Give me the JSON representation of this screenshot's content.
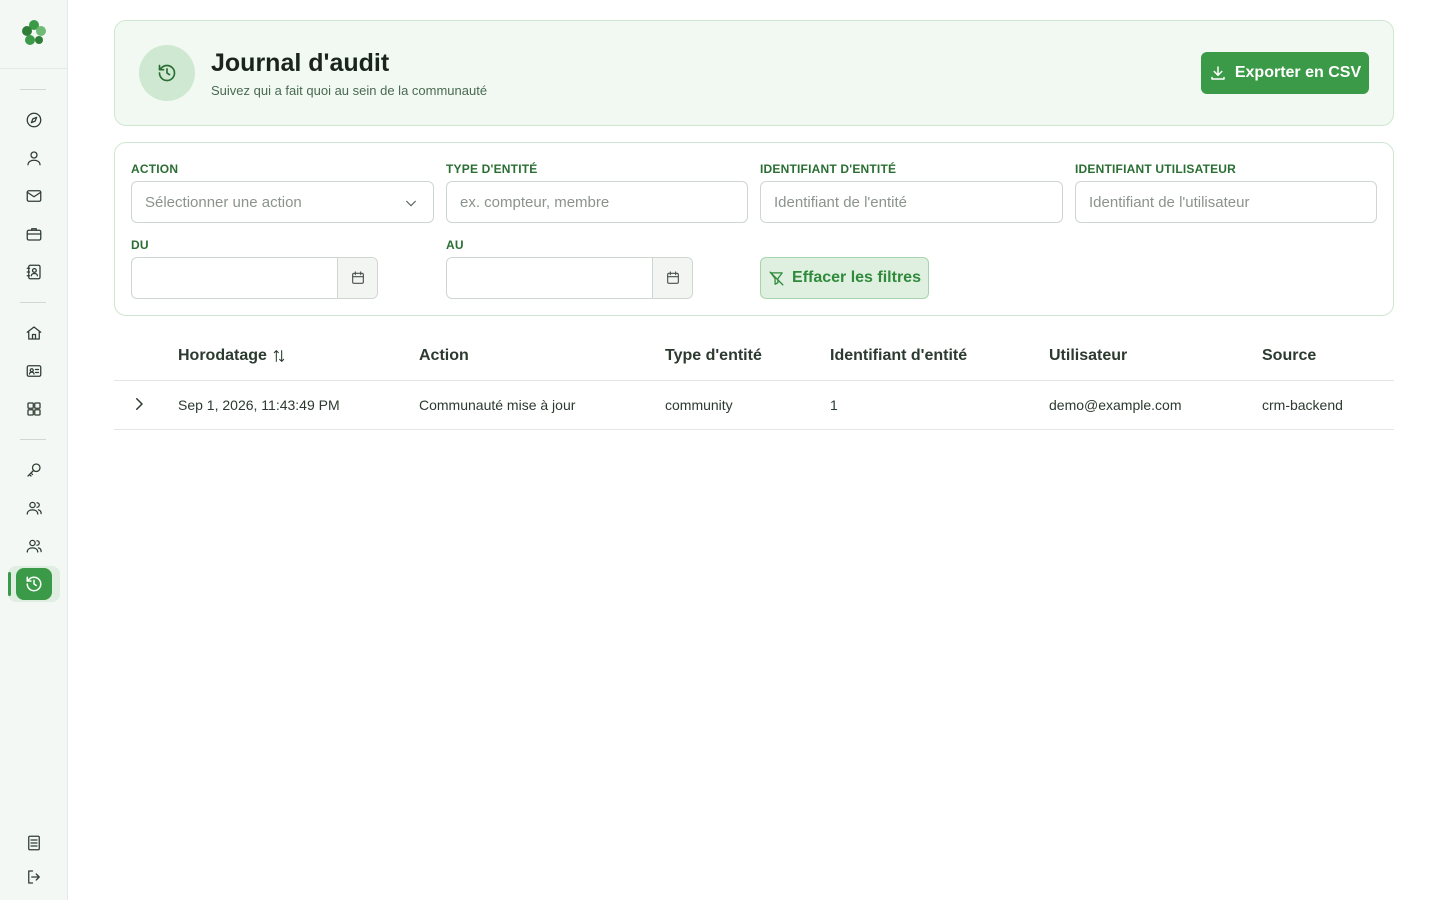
{
  "sidebar": {
    "logo_icon": "clover-logo",
    "items": [
      {
        "icon": "compass-icon",
        "name": "sidebar-item-explore"
      },
      {
        "icon": "user-icon",
        "name": "sidebar-item-profile"
      },
      {
        "icon": "mail-icon",
        "name": "sidebar-item-messages"
      },
      {
        "icon": "briefcase-icon",
        "name": "sidebar-item-jobs"
      },
      {
        "icon": "contact-book-icon",
        "name": "sidebar-item-directory"
      },
      {
        "icon": "home-icon",
        "name": "sidebar-item-home"
      },
      {
        "icon": "id-card-icon",
        "name": "sidebar-item-members"
      },
      {
        "icon": "apps-grid-icon",
        "name": "sidebar-item-apps"
      },
      {
        "icon": "key-icon",
        "name": "sidebar-item-keys"
      },
      {
        "icon": "users-icon",
        "name": "sidebar-item-users"
      },
      {
        "icon": "users-icon",
        "name": "sidebar-item-groups"
      },
      {
        "icon": "history-icon",
        "name": "sidebar-item-audit-log",
        "active": true
      }
    ],
    "bottom": [
      {
        "icon": "document-icon",
        "name": "sidebar-item-docs"
      },
      {
        "icon": "logout-icon",
        "name": "sidebar-item-logout"
      }
    ]
  },
  "header": {
    "title": "Journal d'audit",
    "subtitle": "Suivez qui a fait quoi au sein de la communauté",
    "export_label": "Exporter en CSV"
  },
  "filters": {
    "action_label": "ACTION",
    "action_placeholder": "Sélectionner une action",
    "entity_type_label": "TYPE D'ENTITÉ",
    "entity_type_placeholder": "ex. compteur, membre",
    "entity_id_label": "IDENTIFIANT D'ENTITÉ",
    "entity_id_placeholder": "Identifiant de l'entité",
    "user_id_label": "IDENTIFIANT UTILISATEUR",
    "user_id_placeholder": "Identifiant de l'utilisateur",
    "from_label": "DU",
    "from_value": "",
    "to_label": "AU",
    "to_value": "",
    "clear_label": "Effacer les filtres"
  },
  "table": {
    "columns": [
      "Horodatage",
      "Action",
      "Type d'entité",
      "Identifiant d'entité",
      "Utilisateur",
      "Source"
    ],
    "rows": [
      {
        "timestamp": "Sep 1, 2026, 11:43:49 PM",
        "action": "Communauté mise à jour",
        "entity_type": "community",
        "entity_id": "1",
        "user": "demo@example.com",
        "source": "crm-backend"
      }
    ]
  },
  "colors": {
    "accent": "#3b9a47",
    "accent_light": "#dff0e0",
    "label_green": "#2a6e33"
  }
}
